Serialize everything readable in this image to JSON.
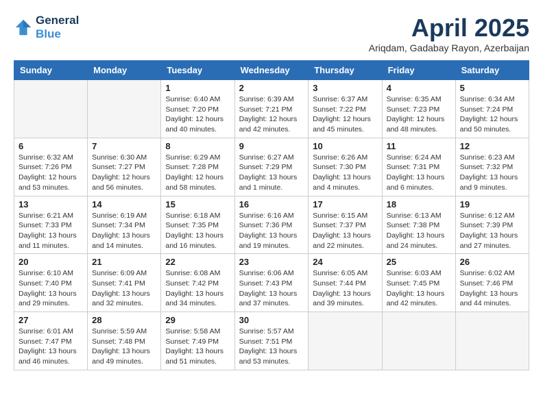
{
  "header": {
    "logo_line1": "General",
    "logo_line2": "Blue",
    "month": "April 2025",
    "location": "Ariqdam, Gadabay Rayon, Azerbaijan"
  },
  "weekdays": [
    "Sunday",
    "Monday",
    "Tuesday",
    "Wednesday",
    "Thursday",
    "Friday",
    "Saturday"
  ],
  "weeks": [
    [
      {
        "day": "",
        "info": ""
      },
      {
        "day": "",
        "info": ""
      },
      {
        "day": "1",
        "info": "Sunrise: 6:40 AM\nSunset: 7:20 PM\nDaylight: 12 hours and 40 minutes."
      },
      {
        "day": "2",
        "info": "Sunrise: 6:39 AM\nSunset: 7:21 PM\nDaylight: 12 hours and 42 minutes."
      },
      {
        "day": "3",
        "info": "Sunrise: 6:37 AM\nSunset: 7:22 PM\nDaylight: 12 hours and 45 minutes."
      },
      {
        "day": "4",
        "info": "Sunrise: 6:35 AM\nSunset: 7:23 PM\nDaylight: 12 hours and 48 minutes."
      },
      {
        "day": "5",
        "info": "Sunrise: 6:34 AM\nSunset: 7:24 PM\nDaylight: 12 hours and 50 minutes."
      }
    ],
    [
      {
        "day": "6",
        "info": "Sunrise: 6:32 AM\nSunset: 7:26 PM\nDaylight: 12 hours and 53 minutes."
      },
      {
        "day": "7",
        "info": "Sunrise: 6:30 AM\nSunset: 7:27 PM\nDaylight: 12 hours and 56 minutes."
      },
      {
        "day": "8",
        "info": "Sunrise: 6:29 AM\nSunset: 7:28 PM\nDaylight: 12 hours and 58 minutes."
      },
      {
        "day": "9",
        "info": "Sunrise: 6:27 AM\nSunset: 7:29 PM\nDaylight: 13 hours and 1 minute."
      },
      {
        "day": "10",
        "info": "Sunrise: 6:26 AM\nSunset: 7:30 PM\nDaylight: 13 hours and 4 minutes."
      },
      {
        "day": "11",
        "info": "Sunrise: 6:24 AM\nSunset: 7:31 PM\nDaylight: 13 hours and 6 minutes."
      },
      {
        "day": "12",
        "info": "Sunrise: 6:23 AM\nSunset: 7:32 PM\nDaylight: 13 hours and 9 minutes."
      }
    ],
    [
      {
        "day": "13",
        "info": "Sunrise: 6:21 AM\nSunset: 7:33 PM\nDaylight: 13 hours and 11 minutes."
      },
      {
        "day": "14",
        "info": "Sunrise: 6:19 AM\nSunset: 7:34 PM\nDaylight: 13 hours and 14 minutes."
      },
      {
        "day": "15",
        "info": "Sunrise: 6:18 AM\nSunset: 7:35 PM\nDaylight: 13 hours and 16 minutes."
      },
      {
        "day": "16",
        "info": "Sunrise: 6:16 AM\nSunset: 7:36 PM\nDaylight: 13 hours and 19 minutes."
      },
      {
        "day": "17",
        "info": "Sunrise: 6:15 AM\nSunset: 7:37 PM\nDaylight: 13 hours and 22 minutes."
      },
      {
        "day": "18",
        "info": "Sunrise: 6:13 AM\nSunset: 7:38 PM\nDaylight: 13 hours and 24 minutes."
      },
      {
        "day": "19",
        "info": "Sunrise: 6:12 AM\nSunset: 7:39 PM\nDaylight: 13 hours and 27 minutes."
      }
    ],
    [
      {
        "day": "20",
        "info": "Sunrise: 6:10 AM\nSunset: 7:40 PM\nDaylight: 13 hours and 29 minutes."
      },
      {
        "day": "21",
        "info": "Sunrise: 6:09 AM\nSunset: 7:41 PM\nDaylight: 13 hours and 32 minutes."
      },
      {
        "day": "22",
        "info": "Sunrise: 6:08 AM\nSunset: 7:42 PM\nDaylight: 13 hours and 34 minutes."
      },
      {
        "day": "23",
        "info": "Sunrise: 6:06 AM\nSunset: 7:43 PM\nDaylight: 13 hours and 37 minutes."
      },
      {
        "day": "24",
        "info": "Sunrise: 6:05 AM\nSunset: 7:44 PM\nDaylight: 13 hours and 39 minutes."
      },
      {
        "day": "25",
        "info": "Sunrise: 6:03 AM\nSunset: 7:45 PM\nDaylight: 13 hours and 42 minutes."
      },
      {
        "day": "26",
        "info": "Sunrise: 6:02 AM\nSunset: 7:46 PM\nDaylight: 13 hours and 44 minutes."
      }
    ],
    [
      {
        "day": "27",
        "info": "Sunrise: 6:01 AM\nSunset: 7:47 PM\nDaylight: 13 hours and 46 minutes."
      },
      {
        "day": "28",
        "info": "Sunrise: 5:59 AM\nSunset: 7:48 PM\nDaylight: 13 hours and 49 minutes."
      },
      {
        "day": "29",
        "info": "Sunrise: 5:58 AM\nSunset: 7:49 PM\nDaylight: 13 hours and 51 minutes."
      },
      {
        "day": "30",
        "info": "Sunrise: 5:57 AM\nSunset: 7:51 PM\nDaylight: 13 hours and 53 minutes."
      },
      {
        "day": "",
        "info": ""
      },
      {
        "day": "",
        "info": ""
      },
      {
        "day": "",
        "info": ""
      }
    ]
  ]
}
